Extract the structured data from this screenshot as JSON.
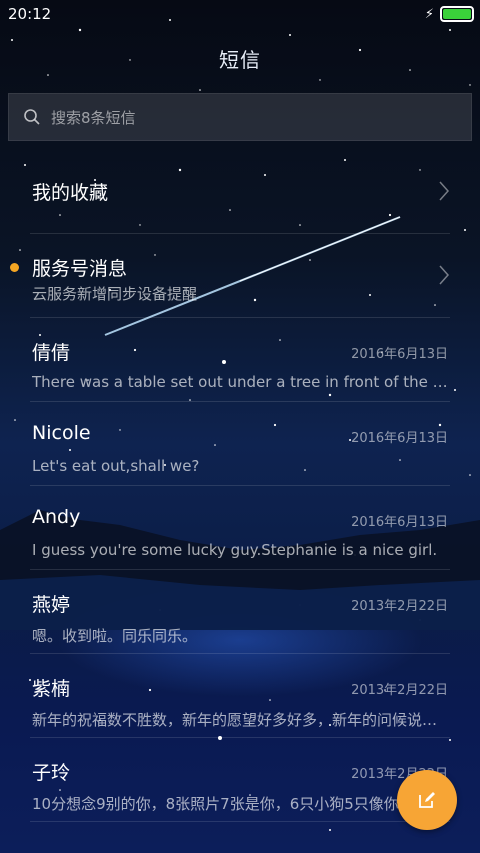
{
  "status_bar": {
    "time": "20:12",
    "battery_level": 1.0,
    "battery_color": "#3ad13a"
  },
  "header": {
    "title": "短信"
  },
  "search": {
    "placeholder": "搜索8条短信",
    "icon": "search-icon"
  },
  "conversations": [
    {
      "name": "我的收藏",
      "date": "",
      "preview": "",
      "chevron": true,
      "unread": false
    },
    {
      "name": "服务号消息",
      "date": "",
      "preview": "云服务新增同步设备提醒",
      "chevron": true,
      "unread": true
    },
    {
      "name": "倩倩",
      "date": "2016年6月13日",
      "preview": "There was a table set out under a tree in front of the house...",
      "chevron": false,
      "unread": false
    },
    {
      "name": "Nicole",
      "date": "2016年6月13日",
      "preview": "Let's eat out,shall we?",
      "chevron": false,
      "unread": false
    },
    {
      "name": "Andy",
      "date": "2016年6月13日",
      "preview": "I guess you're some lucky guy.Stephanie is a nice girl.",
      "chevron": false,
      "unread": false
    },
    {
      "name": "燕婷",
      "date": "2013年2月22日",
      "preview": "嗯。收到啦。同乐同乐。",
      "chevron": false,
      "unread": false
    },
    {
      "name": "紫楠",
      "date": "2013年2月22日",
      "preview": "新年的祝福数不胜数，新年的愿望好多好多，新年的问候说也说不完",
      "chevron": false,
      "unread": false
    },
    {
      "name": "子玲",
      "date": "2013年2月22日",
      "preview": "10分想念9别的你，8张照片7张是你，6只小狗5只像你",
      "chevron": false,
      "unread": false
    }
  ],
  "fab": {
    "icon": "compose-icon",
    "color": "#f7a535"
  },
  "colors": {
    "unread_dot": "#f5a623",
    "accent": "#f7a535"
  }
}
